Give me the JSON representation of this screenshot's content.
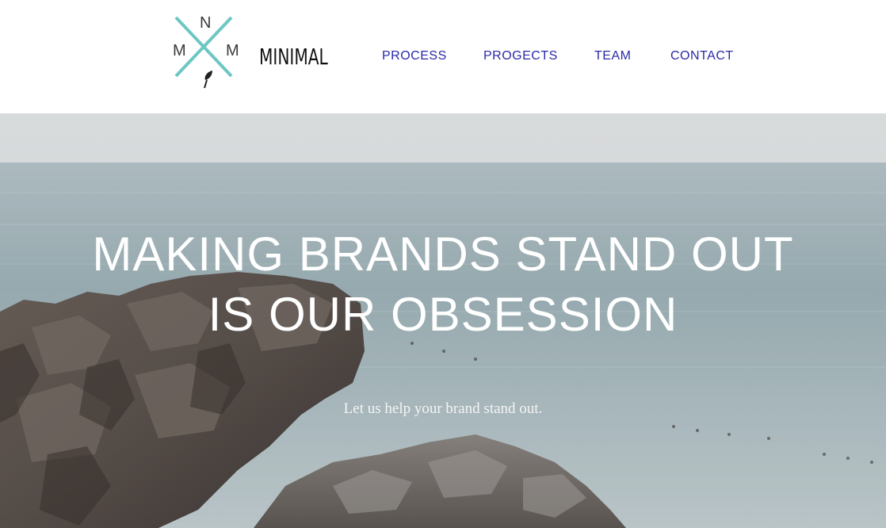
{
  "logo": {
    "letters": {
      "top": "N",
      "left": "M",
      "right": "M"
    },
    "icon": "feather-icon",
    "accent_color": "#6cc7c2"
  },
  "brand": {
    "name": "MINIMAL"
  },
  "nav": {
    "items": [
      {
        "label": "PROCESS"
      },
      {
        "label": "PROGECTS"
      },
      {
        "label": "TEAM"
      },
      {
        "label": "CONTACT"
      }
    ],
    "color": "#2a2aa8"
  },
  "hero": {
    "title_line1": "MAKING BRANDS STAND OUT",
    "title_line2": "IS OUR OBSESSION",
    "subtitle": "Let us help your brand stand out."
  }
}
